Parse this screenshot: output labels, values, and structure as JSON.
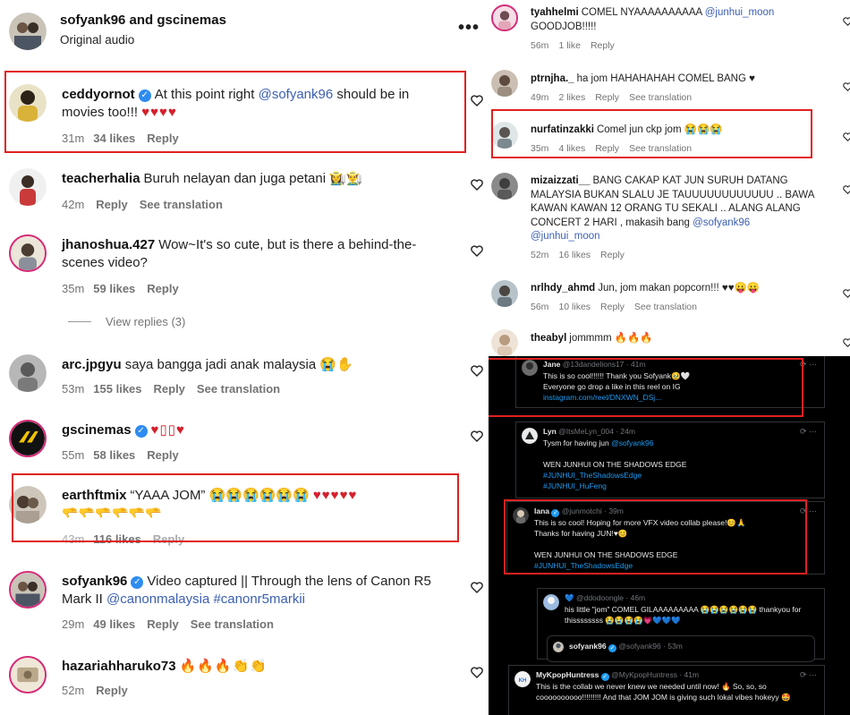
{
  "left": {
    "header": {
      "title": "sofyank96 and gscinemas",
      "subtitle": "Original audio",
      "more": "•••"
    },
    "comments": [
      {
        "user": "ceddyornot",
        "verified": true,
        "pre": "At this point right ",
        "mention": "@sofyank96",
        "post": " should be in movies too!!!",
        "emoji": "♥♥♥♥",
        "time": "31m",
        "likes": "34 likes",
        "reply": "Reply",
        "translate": ""
      },
      {
        "user": "teacherhalia",
        "verified": false,
        "pre": "Buruh nelayan dan juga petani 👩‍🌾👨‍🌾",
        "mention": "",
        "post": "",
        "emoji": "",
        "time": "42m",
        "likes": "",
        "reply": "Reply",
        "translate": "See translation"
      },
      {
        "user": "jhanoshua.427",
        "verified": false,
        "pre": "Wow~It's so cute, but is there a behind-the-scenes video?",
        "mention": "",
        "post": "",
        "emoji": "",
        "time": "35m",
        "likes": "59 likes",
        "reply": "Reply",
        "translate": ""
      },
      {
        "user": "arc.jpgyu",
        "verified": false,
        "pre": "saya bangga jadi anak malaysia 😭✋",
        "mention": "",
        "post": "",
        "emoji": "",
        "time": "53m",
        "likes": "155 likes",
        "reply": "Reply",
        "translate": "See translation"
      },
      {
        "user": "gscinemas",
        "verified": true,
        "pre": "",
        "mention": "",
        "post": "",
        "emoji": "♥▯▯♥",
        "time": "55m",
        "likes": "58 likes",
        "reply": "Reply",
        "translate": ""
      },
      {
        "user": "earthftmix",
        "verified": false,
        "pre": "“YAAA JOM” 😭😭😭😭😭😭",
        "mention": "",
        "post": "",
        "emoji": "♥♥♥♥♥",
        "emoji2": "🫳🫳🫳🫳🫳🫳",
        "time": "43m",
        "likes": "116 likes",
        "reply": "Reply",
        "translate": ""
      },
      {
        "user": "sofyank96",
        "verified": true,
        "pre": "Video captured || Through the lens of Canon R5 Mark II ",
        "mention": "@canonmalaysia #canonr5markii",
        "post": "",
        "emoji": "",
        "time": "29m",
        "likes": "49 likes",
        "reply": "Reply",
        "translate": "See translation"
      },
      {
        "user": "hazariahharuko73",
        "verified": false,
        "pre": "🔥🔥🔥👏👏",
        "mention": "",
        "post": "",
        "emoji": "",
        "time": "52m",
        "likes": "",
        "reply": "Reply",
        "translate": ""
      }
    ],
    "view_replies": "View replies (3)"
  },
  "right_top": {
    "comments": [
      {
        "user": "tyahhelmi",
        "pre": "COMEL NYAAAAAAAAAA ",
        "mention": "@junhui_moon",
        "post": " GOODJOB!!!!!",
        "time": "56m",
        "likes": "1 like",
        "reply": "Reply",
        "translate": ""
      },
      {
        "user": "ptrnjha._",
        "pre": "ha jom HAHAHAHAH COMEL BANG ♥",
        "mention": "",
        "post": "",
        "time": "49m",
        "likes": "2 likes",
        "reply": "Reply",
        "translate": "See translation"
      },
      {
        "user": "nurfatinzakki",
        "pre": "Comel jun ckp jom 😭😭😭",
        "mention": "",
        "post": "",
        "time": "35m",
        "likes": "4 likes",
        "reply": "Reply",
        "translate": "See translation"
      },
      {
        "user": "mizaizzati__",
        "pre": "BANG CAKAP KAT JUN SURUH DATANG MALAYSIA BUKAN SLALU JE TAUUUUUUUUUUUU .. BAWA KAWAN KAWAN 12 ORANG TU SEKALI .. ALANG ALANG CONCERT 2 HARI , makasih bang ",
        "mention": "@sofyank96 @junhui_moon",
        "post": "",
        "time": "52m",
        "likes": "16 likes",
        "reply": "Reply",
        "translate": ""
      },
      {
        "user": "nrlhdy_ahmd",
        "pre": "Jun, jom makan popcorn!!! ♥♥😛😛",
        "mention": "",
        "post": "",
        "time": "56m",
        "likes": "10 likes",
        "reply": "Reply",
        "translate": "See translation"
      },
      {
        "user": "theabyl",
        "pre": "jommmm 🔥🔥🔥",
        "mention": "",
        "post": "",
        "time": "",
        "likes": "",
        "reply": "",
        "translate": ""
      }
    ]
  },
  "right_bottom": {
    "tweets": [
      {
        "name": "Jane",
        "handle": "@13dandelions17 · 41m",
        "lines": [
          "This is so cool!!!!!! Thank you Sofyank🥹🤍",
          "Everyone go drop a like in this reel on IG"
        ],
        "link": "instagram.com/reel/DNXWN_DSj..."
      },
      {
        "name": "Lyn",
        "handle": "@ItsMeLyn_004 · 24m",
        "lines": [
          "Tysm for having jun ",
          "",
          "WEN JUNHUI ON THE SHADOWS EDGE"
        ],
        "mention": "@sofyank96",
        "tags": [
          "#JUNHUI_TheShadowsEdge",
          "#JUNHUI_HuFeng"
        ]
      },
      {
        "name": "Iana",
        "handle": "@junmotchi · 39m",
        "lines": [
          "This is so cool! Hoping for more VFX video collab please!😊🙏",
          "Thanks for having JUN!♥😊",
          "",
          "WEN JUNHUI ON THE SHADOWS EDGE"
        ],
        "tags": [
          "#JUNHUI_TheShadowsEdge"
        ]
      },
      {
        "name": "💙",
        "handle": "@ddodoongle · 46m",
        "lines": [
          "his little \"jom\" COMEL GILAAAAAAAAA 😭😭😭😭😭😭 thankyou for",
          "thissssssss 😭😭😭😭💗💙💙💙"
        ]
      },
      {
        "name": "sofyank96",
        "handle": "@sofyank96 · 53m",
        "lines": []
      },
      {
        "name": "MyKpopHuntress",
        "handle": "@MyKpopHuntress · 41m",
        "lines": [
          "This is the collab we never knew we needed until now! 🔥 So, so, so",
          "coooooooooo!!!!!!!!! And that JOM JOM is giving such lokal vibes hokeyy 🤩"
        ]
      }
    ]
  },
  "colors": {
    "mention": "#3b5fb3",
    "highlight": "#e02020",
    "twitter_link": "#1d9bf0"
  }
}
